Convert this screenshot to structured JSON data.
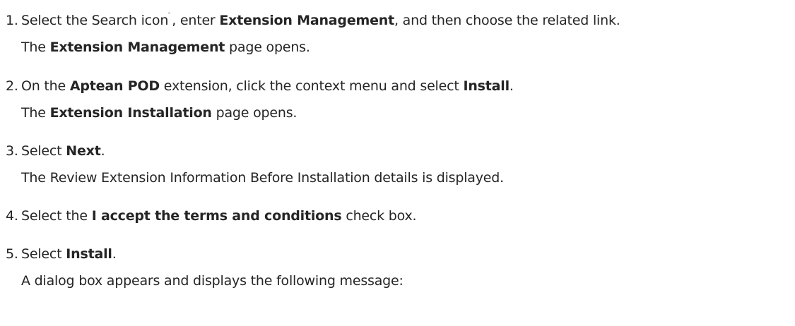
{
  "steps": [
    {
      "number": "1.",
      "parts": [
        "Select the Search icon",
        ", enter ",
        "Extension Management",
        ", and then choose the related link."
      ],
      "result_parts": [
        "The ",
        "Extension Management",
        " page opens."
      ]
    },
    {
      "number": "2.",
      "parts": [
        "On the ",
        "Aptean POD",
        " extension, click the context menu and select ",
        "Install",
        "."
      ],
      "result_parts": [
        "The ",
        "Extension Installation",
        " page opens."
      ]
    },
    {
      "number": "3.",
      "parts": [
        "Select ",
        "Next",
        "."
      ],
      "result": "The Review Extension Information Before Installation details is displayed."
    },
    {
      "number": "4.",
      "parts": [
        "Select the ",
        "I accept the terms and conditions",
        " check box."
      ]
    },
    {
      "number": "5.",
      "parts": [
        "Select ",
        "Install",
        "."
      ],
      "result": "A dialog box appears and displays the following message:"
    }
  ],
  "icons": {
    "search": "search-icon"
  }
}
